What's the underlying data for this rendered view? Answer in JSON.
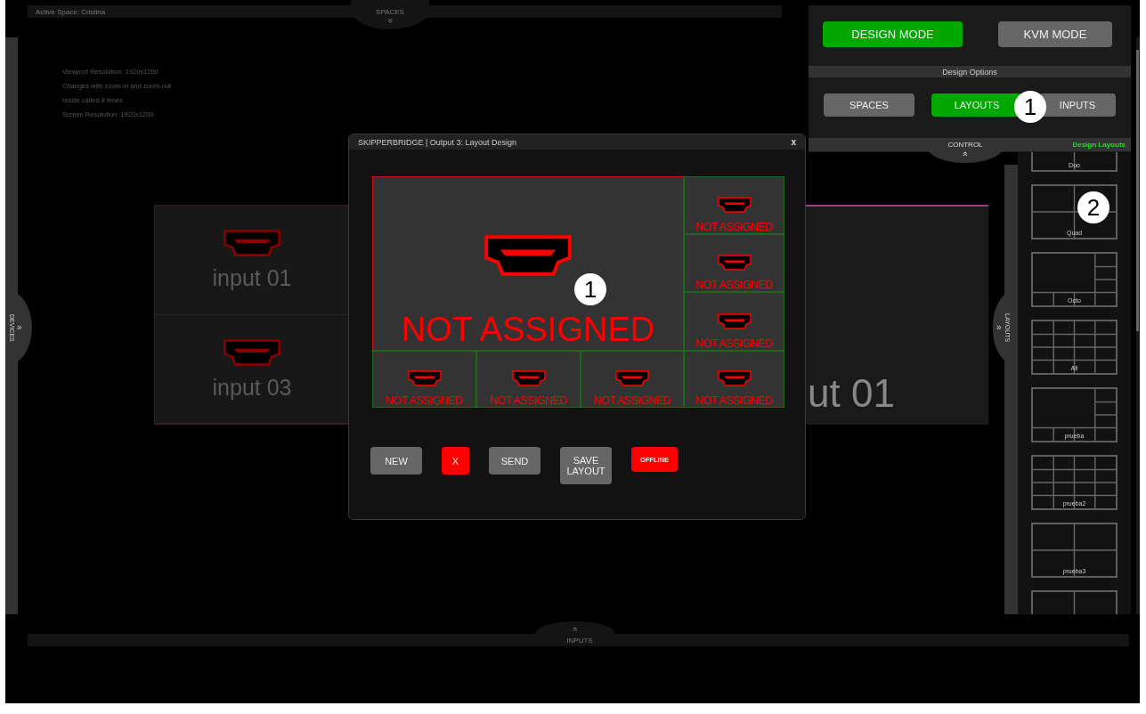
{
  "top_bar": {
    "active_space": "Active Space: Cristina"
  },
  "spaces_tab": {
    "label": "SPACES",
    "arrow": "»"
  },
  "devices_tab": {
    "label": "DEVICES",
    "arrow": "»"
  },
  "info_lines": [
    "Viewport Resolution :1920x1200",
    "Changes with zoom-in and zoom-out",
    "resize called 8 times",
    "Screen Resolution :1920x1200"
  ],
  "canvas": {
    "cells": [
      {
        "label": "input 01"
      },
      {
        "label": "input 03"
      }
    ],
    "output_label": "ut 01"
  },
  "control_panel": {
    "modes": [
      {
        "label": "DESIGN MODE",
        "selected": true
      },
      {
        "label": "KVM MODE",
        "selected": false
      }
    ],
    "options_title": "Design Options",
    "options": [
      {
        "label": "SPACES",
        "selected": false
      },
      {
        "label": "LAYOUTS",
        "selected": true,
        "callout": "1"
      },
      {
        "label": "INPUTS",
        "selected": false
      }
    ],
    "tab": {
      "label": "CONTROL",
      "arrow": "»"
    },
    "section_label": "Design Layouts"
  },
  "layouts_tab": {
    "label": "LAYOUTS",
    "arrow": "»"
  },
  "layouts": [
    {
      "name": "Duo",
      "kind": "duo"
    },
    {
      "name": "Quad",
      "kind": "quad",
      "callout": "2"
    },
    {
      "name": "Octo",
      "kind": "octo"
    },
    {
      "name": "All",
      "kind": "all"
    },
    {
      "name": "prueba",
      "kind": "octo"
    },
    {
      "name": "prueba2",
      "kind": "all"
    },
    {
      "name": "prueba3",
      "kind": "quad"
    },
    {
      "kind": "duo"
    }
  ],
  "dialog": {
    "title": "SKIPPERBRIDGE | Output 3: Layout Design",
    "close": "x",
    "cells": [
      {
        "label": "NOT ASSIGNED",
        "kind": "main",
        "selected": true,
        "callout": "1"
      },
      {
        "label": "NOT ASSIGNED",
        "kind": "small",
        "selected": false
      },
      {
        "label": "NOT ASSIGNED",
        "kind": "small",
        "selected": false
      },
      {
        "label": "NOT ASSIGNED",
        "kind": "small",
        "selected": false
      },
      {
        "label": "NOT ASSIGNED",
        "kind": "small",
        "selected": false
      },
      {
        "label": "NOT ASSIGNED",
        "kind": "small",
        "selected": false
      },
      {
        "label": "NOT ASSIGNED",
        "kind": "small",
        "selected": false
      },
      {
        "label": "NOT ASSIGNED",
        "kind": "small",
        "selected": false
      }
    ],
    "buttons": [
      {
        "label": "NEW",
        "kind": "default"
      },
      {
        "label": "X",
        "kind": "danger"
      },
      {
        "label": "SEND",
        "kind": "default"
      },
      {
        "label": "SAVE LAYOUT",
        "kind": "default"
      },
      {
        "label": "OFFLINE",
        "kind": "status"
      }
    ]
  },
  "inputs_tab": {
    "label": "INPUTS",
    "arrow": "»"
  }
}
